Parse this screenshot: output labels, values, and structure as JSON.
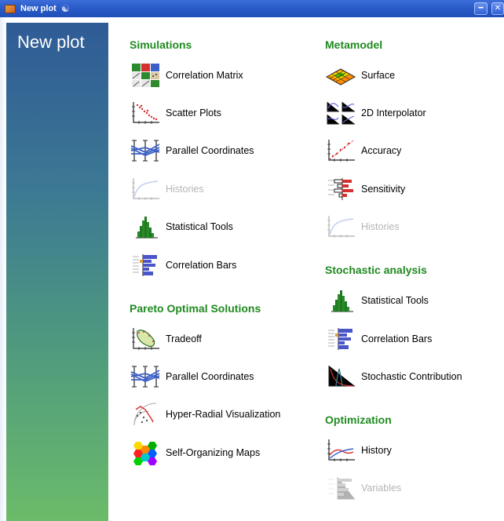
{
  "window": {
    "title": "New plot"
  },
  "sidebar": {
    "title": "New plot"
  },
  "sections": {
    "simulations": {
      "title": "Simulations",
      "items": [
        {
          "label": "Correlation Matrix",
          "icon": "correlation-matrix-icon",
          "enabled": true
        },
        {
          "label": "Scatter Plots",
          "icon": "scatter-plot-icon",
          "enabled": true
        },
        {
          "label": "Parallel Coordinates",
          "icon": "parallel-coordinates-icon",
          "enabled": true
        },
        {
          "label": "Histories",
          "icon": "histories-icon",
          "enabled": false
        },
        {
          "label": "Statistical Tools",
          "icon": "histogram-icon",
          "enabled": true
        },
        {
          "label": "Correlation Bars",
          "icon": "correlation-bars-icon",
          "enabled": true
        }
      ]
    },
    "pareto": {
      "title": "Pareto Optimal Solutions",
      "items": [
        {
          "label": "Tradeoff",
          "icon": "tradeoff-icon",
          "enabled": true
        },
        {
          "label": "Parallel Coordinates",
          "icon": "parallel-coordinates-icon",
          "enabled": true
        },
        {
          "label": "Hyper-Radial Visualization",
          "icon": "hyper-radial-icon",
          "enabled": true
        },
        {
          "label": "Self-Organizing Maps",
          "icon": "self-organizing-maps-icon",
          "enabled": true
        }
      ]
    },
    "metamodel": {
      "title": "Metamodel",
      "items": [
        {
          "label": "Surface",
          "icon": "surface-icon",
          "enabled": true
        },
        {
          "label": "2D Interpolator",
          "icon": "interpolator-icon",
          "enabled": true
        },
        {
          "label": "Accuracy",
          "icon": "accuracy-icon",
          "enabled": true
        },
        {
          "label": "Sensitivity",
          "icon": "sensitivity-icon",
          "enabled": true
        },
        {
          "label": "Histories",
          "icon": "histories-icon",
          "enabled": false
        }
      ]
    },
    "stochastic": {
      "title": "Stochastic analysis",
      "items": [
        {
          "label": "Statistical Tools",
          "icon": "histogram-icon",
          "enabled": true
        },
        {
          "label": "Correlation Bars",
          "icon": "correlation-bars-icon",
          "enabled": true
        },
        {
          "label": "Stochastic Contribution",
          "icon": "stochastic-contribution-icon",
          "enabled": true
        }
      ]
    },
    "optimization": {
      "title": "Optimization",
      "items": [
        {
          "label": "History",
          "icon": "history-icon",
          "enabled": true
        },
        {
          "label": "Variables",
          "icon": "variables-icon",
          "enabled": false
        }
      ]
    }
  },
  "colors": {
    "section_title": "#1f8a20",
    "disabled_text": "#b5b5b5",
    "titlebar": "#2a5bc8"
  }
}
